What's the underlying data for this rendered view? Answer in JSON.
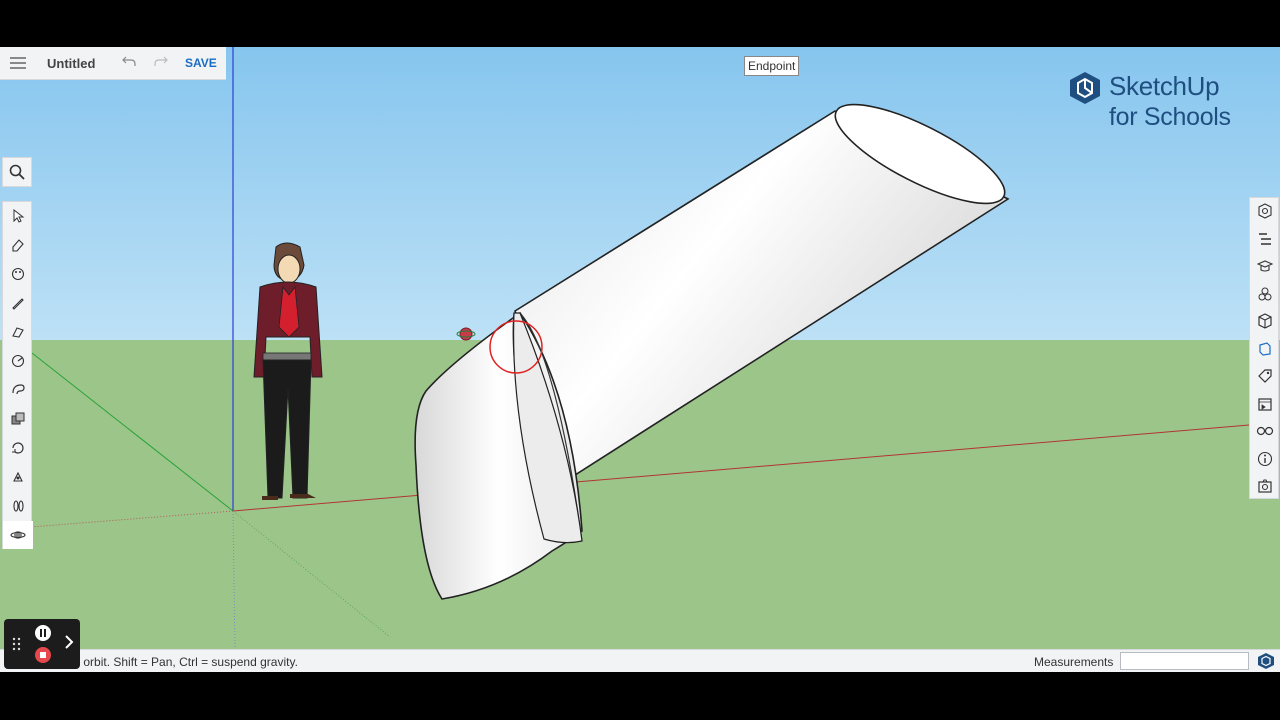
{
  "app": {
    "title": "Untitled",
    "save_label": "SAVE",
    "brand_line1": "SketchUp",
    "brand_line2": "for Schools",
    "brand_color": "#1f4f80",
    "accent_color": "#1a6dc4"
  },
  "toolbar": {
    "icons": [
      "hamburger-menu-icon",
      "undo-icon",
      "redo-icon"
    ]
  },
  "left_tools": [
    {
      "name": "select-icon",
      "active": false
    },
    {
      "name": "eraser-icon",
      "active": false
    },
    {
      "name": "paint-bucket-icon",
      "active": false
    },
    {
      "name": "pencil-icon",
      "active": false
    },
    {
      "name": "tape-measure-icon",
      "active": false
    },
    {
      "name": "protractor-icon",
      "active": false
    },
    {
      "name": "follow-me-icon",
      "active": false
    },
    {
      "name": "push-pull-icon",
      "active": false
    },
    {
      "name": "rotate-icon",
      "active": false
    },
    {
      "name": "position-camera-icon",
      "active": false
    },
    {
      "name": "walk-icon",
      "active": false
    },
    {
      "name": "orbit-icon",
      "active": true
    }
  ],
  "right_tools": [
    "entity-info-icon",
    "outliner-icon",
    "instructor-icon",
    "components-icon",
    "materials-icon",
    "styles-icon",
    "tags-icon",
    "scenes-icon",
    "display-icon",
    "info-icon",
    "export-icon"
  ],
  "viewport": {
    "tooltip": "Endpoint"
  },
  "status": {
    "hint": "g to orbit. Shift = Pan, Ctrl = suspend gravity.",
    "measurements_label": "Measurements",
    "measurements_value": ""
  },
  "recorder": {
    "icons": [
      "drag-handle-icon",
      "pause-icon",
      "stop-icon",
      "chevron-right-icon"
    ]
  }
}
